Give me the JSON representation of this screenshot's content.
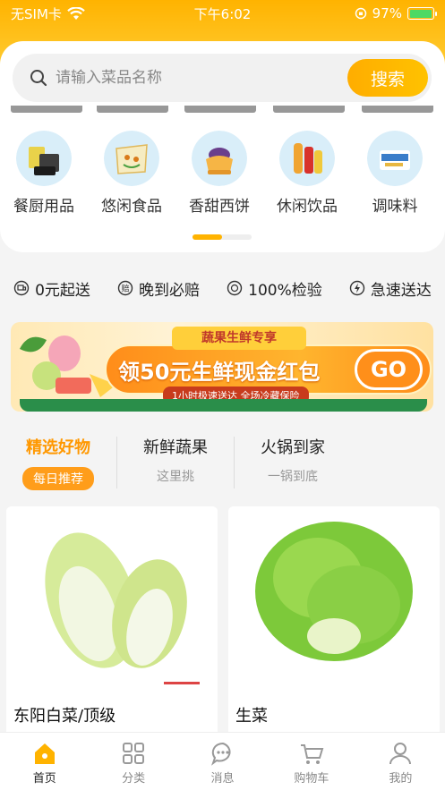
{
  "status_bar": {
    "carrier": "无SIM卡",
    "time": "下午6:02",
    "battery": "97%",
    "battery_level": 0.97
  },
  "search": {
    "placeholder": "请输入菜品名称",
    "button_label": "搜索"
  },
  "categories": [
    {
      "label": "餐厨用品",
      "icon": "tableware-icon"
    },
    {
      "label": "悠闲食品",
      "icon": "snack-icon"
    },
    {
      "label": "香甜西饼",
      "icon": "cake-icon"
    },
    {
      "label": "休闲饮品",
      "icon": "drink-icon"
    },
    {
      "label": "调味料",
      "icon": "seasoning-icon"
    }
  ],
  "category_page_indicator": {
    "current": 1,
    "total": 2
  },
  "services": [
    {
      "label": "0元起送",
      "icon": "delivery-icon"
    },
    {
      "label": "晚到必赔",
      "icon": "compensation-icon"
    },
    {
      "label": "100%检验",
      "icon": "inspection-icon"
    },
    {
      "label": "急速送达",
      "icon": "lightning-icon"
    }
  ],
  "banner": {
    "tag": "蔬果生鲜专享",
    "main": "领50元生鲜现金红包",
    "sub": "1小时极速送达 全场冷藏保险",
    "cta": "GO"
  },
  "tabs": [
    {
      "title": "精选好物",
      "subtitle": "每日推荐",
      "active": true
    },
    {
      "title": "新鲜蔬果",
      "subtitle": "这里挑",
      "active": false
    },
    {
      "title": "火锅到家",
      "subtitle": "一锅到底",
      "active": false
    }
  ],
  "products": [
    {
      "name": "东阳白菜/顶级",
      "image": "napa-cabbage-image"
    },
    {
      "name": "生菜",
      "image": "lettuce-image"
    }
  ],
  "bottom_nav": [
    {
      "label": "首页",
      "icon": "home-icon",
      "active": true
    },
    {
      "label": "分类",
      "icon": "category-grid-icon",
      "active": false
    },
    {
      "label": "消息",
      "icon": "message-icon",
      "active": false
    },
    {
      "label": "购物车",
      "icon": "cart-icon",
      "active": false
    },
    {
      "label": "我的",
      "icon": "user-icon",
      "active": false
    }
  ],
  "colors": {
    "accent": "#ffb300",
    "accent_text": "#ff9800",
    "battery_green": "#4cd964"
  }
}
